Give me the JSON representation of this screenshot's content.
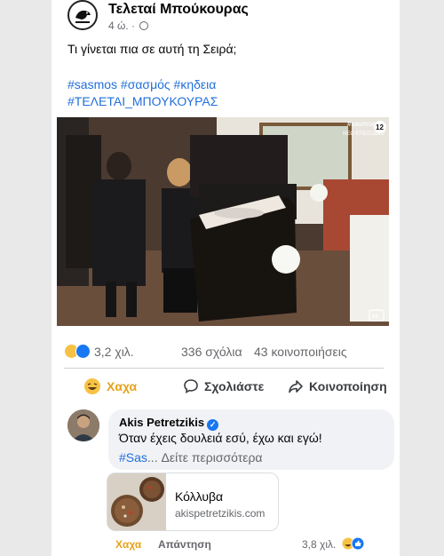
{
  "post": {
    "page_name": "Τελεταί Μπούκουρας",
    "age": "4 ώ. ·",
    "text": "Τι γίνεται πια σε αυτή τη Σειρά;",
    "hashtags_line1": "#sasmos #σασμός #κηδεια",
    "hashtags_line2": "#ΤΕΛΕΤΑΙ_ΜΠΟΥΚΟΥΡΑΣ",
    "video_overlay": "#sasmos",
    "video_overlay_sub": "ΝΕΟ ΕΠΕΙΣΟΔΙΟ",
    "video_rating": "12",
    "video_cc": "cc"
  },
  "stats": {
    "reactions_count": "3,2 χιλ.",
    "comments": "336 σχόλια",
    "shares": "43 κοινοποιήσεις"
  },
  "actions": {
    "haha": "Χαχα",
    "comment": "Σχολιάστε",
    "share": "Κοινοποίηση"
  },
  "comment": {
    "author": "Akis Petretzikis",
    "text": "Όταν έχεις δουλειά εσύ, έχω και εγώ!",
    "hashtag": "#Sas",
    "see_more": "... Δείτε περισσότερα",
    "link_title": "Κόλλυβα",
    "link_domain": "akispetretzikis.com",
    "haha_label": "Χαχα",
    "reply_label": "Απάντηση",
    "reactions_count": "3,8 χιλ."
  },
  "colors": {
    "accent_blue": "#216fdb",
    "haha_yellow": "#e7a21a",
    "like_blue": "#1877f2"
  }
}
